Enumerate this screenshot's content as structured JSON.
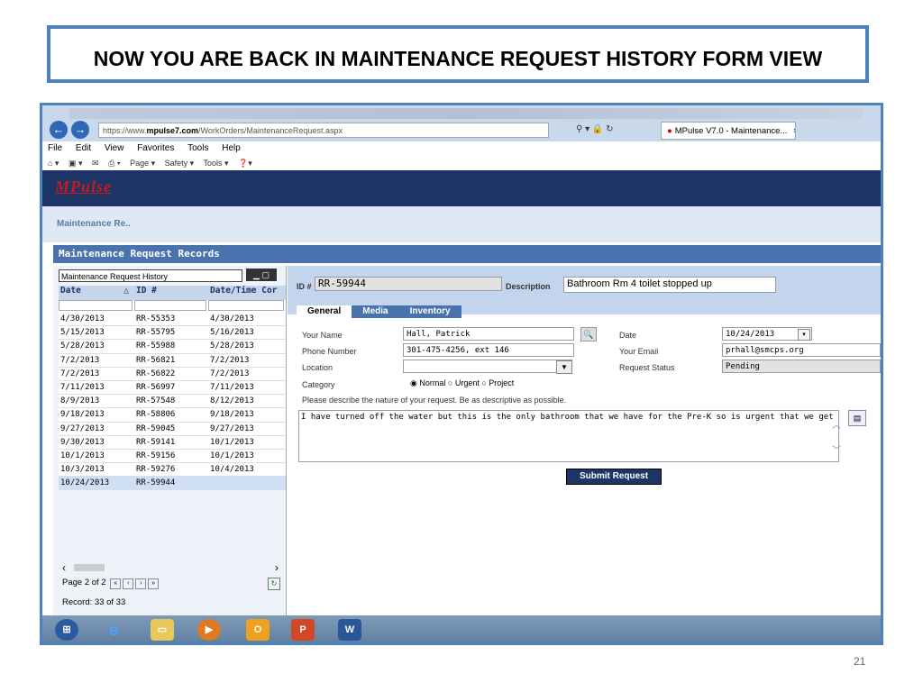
{
  "slide": {
    "title": "NOW YOU ARE BACK IN MAINTENANCE REQUEST HISTORY FORM VIEW",
    "page_number": "21"
  },
  "browser": {
    "url_prefix": "https://www.",
    "url_host": "mpulse7.com",
    "url_path": "/WorkOrders/MaintenanceRequest.aspx",
    "tab_title": "MPulse V7.0 - Maintenance...",
    "tab_close": "×",
    "menu": [
      "File",
      "Edit",
      "View",
      "Favorites",
      "Tools",
      "Help"
    ],
    "commands": [
      "Page ▾",
      "Safety ▾",
      "Tools ▾"
    ]
  },
  "app": {
    "logo": "MPulse",
    "breadcrumb": "Maintenance Re..",
    "records_title": "Maintenance Request Records"
  },
  "history": {
    "panel_title": "Maintenance Request History",
    "columns": [
      "Date",
      "ID #",
      "Date/Time Cor"
    ],
    "rows": [
      [
        "4/30/2013",
        "RR-55353",
        "4/30/2013"
      ],
      [
        "5/15/2013",
        "RR-55795",
        "5/16/2013"
      ],
      [
        "5/28/2013",
        "RR-55988",
        "5/28/2013"
      ],
      [
        "7/2/2013",
        "RR-56821",
        "7/2/2013"
      ],
      [
        "7/2/2013",
        "RR-56822",
        "7/2/2013"
      ],
      [
        "7/11/2013",
        "RR-56997",
        "7/11/2013"
      ],
      [
        "8/9/2013",
        "RR-57548",
        "8/12/2013"
      ],
      [
        "9/18/2013",
        "RR-58806",
        "9/18/2013"
      ],
      [
        "9/27/2013",
        "RR-59045",
        "9/27/2013"
      ],
      [
        "9/30/2013",
        "RR-59141",
        "10/1/2013"
      ],
      [
        "10/1/2013",
        "RR-59156",
        "10/1/2013"
      ],
      [
        "10/3/2013",
        "RR-59276",
        "10/4/2013"
      ],
      [
        "10/24/2013",
        "RR-59944",
        ""
      ]
    ],
    "page_text": "Page 2 of 2",
    "record_text": "Record: 33 of 33"
  },
  "form": {
    "id_label": "ID #",
    "id_value": "RR-59944",
    "description_label": "Description",
    "description_value": "Bathroom Rm 4 toilet stopped up",
    "tabs": [
      "General",
      "Media",
      "Inventory"
    ],
    "your_name_label": "Your Name",
    "your_name_value": "Hall, Patrick",
    "phone_label": "Phone Number",
    "phone_value": "301-475-4256, ext 146",
    "location_label": "Location",
    "location_value": "",
    "category_label": "Category",
    "category_options": [
      "Normal",
      "Urgent",
      "Project"
    ],
    "category_selected": "Normal",
    "date_label": "Date",
    "date_value": "10/24/2013",
    "email_label": "Your Email",
    "email_value": "prhall@smcps.org",
    "status_label": "Request Status",
    "status_value": "Pending",
    "describe_prompt": "Please describe the nature of your request. Be as descriptive as possible.",
    "describe_value": "I have turned off the water but this is the only bathroom that we have for the Pre-K so is urgent that we get it running aga",
    "submit_label": "Submit Request"
  },
  "taskbar": {
    "apps": [
      "start-icon",
      "ie-icon",
      "explorer-icon",
      "media-icon",
      "outlook-icon",
      "powerpoint-icon",
      "word-icon"
    ]
  }
}
